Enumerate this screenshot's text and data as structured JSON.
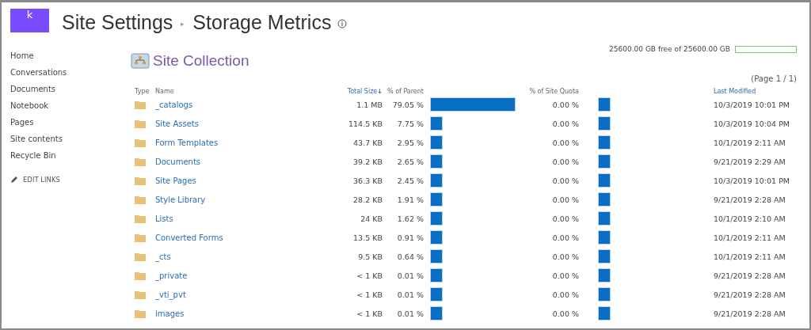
{
  "header": {
    "logo_letter": "k",
    "breadcrumb": [
      "Site Settings",
      "Storage Metrics"
    ],
    "separator": "▸"
  },
  "sidebar": {
    "items": [
      {
        "label": "Home"
      },
      {
        "label": "Conversations"
      },
      {
        "label": "Documents"
      },
      {
        "label": "Notebook"
      },
      {
        "label": "Pages"
      },
      {
        "label": "Site contents"
      },
      {
        "label": "Recycle Bin"
      }
    ],
    "edit_links": "EDIT LINKS"
  },
  "section_title": "Site Collection",
  "quota": {
    "text": "25600.00 GB free of 25600.00 GB",
    "level": 0
  },
  "pager": "(Page 1 / 1)",
  "table": {
    "columns": [
      {
        "label": "Type",
        "sortable": false
      },
      {
        "label": "Name",
        "sortable": false
      },
      {
        "label": "Total Size",
        "sortable": true,
        "sort_arrow": "↓"
      },
      {
        "label": "% of Parent",
        "sortable": false
      },
      {
        "label": "% of Site Quota",
        "sortable": false
      },
      {
        "label": "Last Modified",
        "sortable": true
      }
    ],
    "rows": [
      {
        "name": "_catalogs",
        "size": "1.1 MB",
        "parent_pct": "79.05 %",
        "quota_pct": "0.00 %",
        "modified": "10/3/2019 10:01 PM"
      },
      {
        "name": "Site Assets",
        "size": "114.5 KB",
        "parent_pct": "7.75 %",
        "quota_pct": "0.00 %",
        "modified": "10/3/2019 10:04 PM"
      },
      {
        "name": "Form Templates",
        "size": "43.7 KB",
        "parent_pct": "2.95 %",
        "quota_pct": "0.00 %",
        "modified": "10/1/2019 2:11 AM"
      },
      {
        "name": "Documents",
        "size": "39.2 KB",
        "parent_pct": "2.65 %",
        "quota_pct": "0.00 %",
        "modified": "9/21/2019 2:29 AM"
      },
      {
        "name": "Site Pages",
        "size": "36.3 KB",
        "parent_pct": "2.45 %",
        "quota_pct": "0.00 %",
        "modified": "10/3/2019 10:01 PM"
      },
      {
        "name": "Style Library",
        "size": "28.2 KB",
        "parent_pct": "1.91 %",
        "quota_pct": "0.00 %",
        "modified": "9/21/2019 2:28 AM"
      },
      {
        "name": "Lists",
        "size": "24 KB",
        "parent_pct": "1.62 %",
        "quota_pct": "0.00 %",
        "modified": "10/1/2019 2:10 AM"
      },
      {
        "name": "Converted Forms",
        "size": "13.5 KB",
        "parent_pct": "0.91 %",
        "quota_pct": "0.00 %",
        "modified": "10/1/2019 2:11 AM"
      },
      {
        "name": "_cts",
        "size": "9.5 KB",
        "parent_pct": "0.64 %",
        "quota_pct": "0.00 %",
        "modified": "10/1/2019 2:11 AM"
      },
      {
        "name": "_private",
        "size": "< 1 KB",
        "parent_pct": "0.01 %",
        "quota_pct": "0.00 %",
        "modified": "9/21/2019 2:28 AM"
      },
      {
        "name": "_vti_pvt",
        "size": "< 1 KB",
        "parent_pct": "0.01 %",
        "quota_pct": "0.00 %",
        "modified": "9/21/2019 2:28 AM"
      },
      {
        "name": "images",
        "size": "< 1 KB",
        "parent_pct": "0.01 %",
        "quota_pct": "0.00 %",
        "modified": "9/21/2019 2:28 AM"
      }
    ]
  }
}
